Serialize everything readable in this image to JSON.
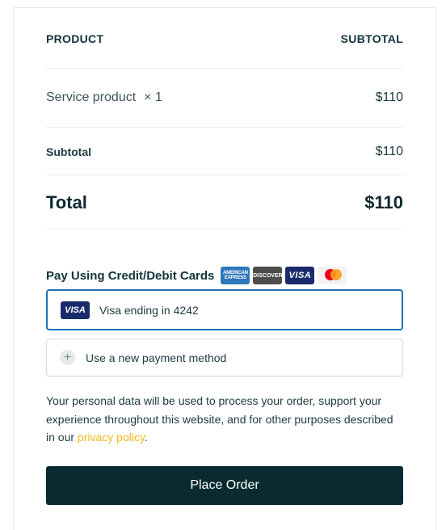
{
  "table": {
    "header_product": "PRODUCT",
    "header_subtotal": "SUBTOTAL",
    "item_name": "Service product",
    "item_qty": "× 1",
    "item_price": "$110",
    "subtotal_label": "Subtotal",
    "subtotal_value": "$110",
    "total_label": "Total",
    "total_value": "$110"
  },
  "payment": {
    "title": "Pay Using Credit/Debit Cards",
    "brands": {
      "amex": "AMERICAN EXPRESS",
      "discover": "DISCOVER",
      "visa": "VISA",
      "mastercard": "mastercard"
    },
    "saved_card_brand": "VISA",
    "saved_card_label": "Visa ending in 4242",
    "new_method_icon": "+",
    "new_method_label": "Use a new payment method"
  },
  "privacy": {
    "text": "Your personal data will be used to process your order, support your experience throughout this website, and for other purposes described in our ",
    "link_text": "privacy policy",
    "suffix": "."
  },
  "actions": {
    "place_order": "Place Order"
  },
  "colors": {
    "primary_dark": "#082a30",
    "accent_link": "#f3b81b",
    "selected_border": "#1f6fb4"
  }
}
